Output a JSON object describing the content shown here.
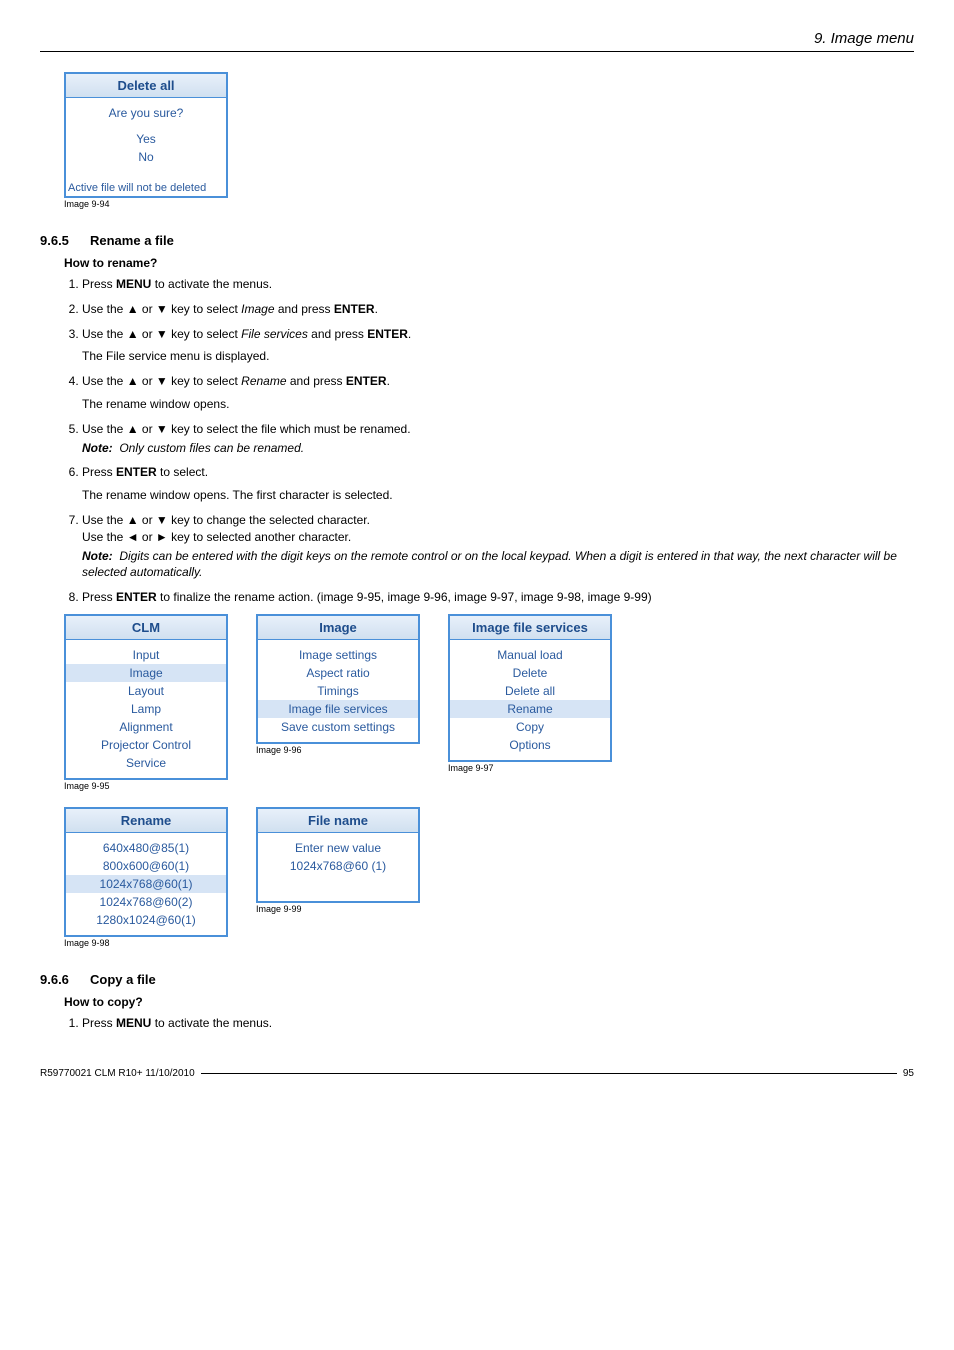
{
  "chapter": "9. Image menu",
  "dialog94": {
    "title": "Delete all",
    "prompt": "Are you sure?",
    "yes": "Yes",
    "no": "No",
    "footer": "Active file will not be deleted",
    "caption": "Image 9-94"
  },
  "section965": {
    "num": "9.6.5",
    "title": "Rename a file",
    "sub": "How to rename?",
    "steps": {
      "s1": "Press ",
      "s1b": "MENU",
      "s1c": " to activate the menus.",
      "s2a": "Use the ▲ or ▼ key to select ",
      "s2i": "Image",
      "s2b": " and press ",
      "s2c": "ENTER",
      "s2d": ".",
      "s3a": "Use the ▲ or ▼ key to select ",
      "s3i": "File services",
      "s3b": " and press ",
      "s3c": "ENTER",
      "s3d": ".",
      "s3e": "The File service menu is displayed.",
      "s4a": "Use the ▲ or ▼ key to select ",
      "s4i": "Rename",
      "s4b": " and press ",
      "s4c": "ENTER",
      "s4d": ".",
      "s4e": "The rename window opens.",
      "s5a": "Use the ▲ or ▼ key to select the file which must be renamed.",
      "s5note": "Only custom files can be renamed.",
      "s6a": "Press ",
      "s6b": "ENTER",
      "s6c": " to select.",
      "s6d": "The rename window opens. The first character is selected.",
      "s7a": "Use the ▲ or ▼ key to change the selected character.",
      "s7b": "Use the ◄ or ► key to selected another character.",
      "s7note": "Digits can be entered with the digit keys on the remote control or on the local keypad. When a digit is entered in that way, the next character will be selected automatically.",
      "s8a": "Press ",
      "s8b": "ENTER",
      "s8c": " to finalize the rename action. (image 9-95, image 9-96, image 9-97, image 9-98, image 9-99)"
    }
  },
  "notelabel": "Note:",
  "menu95": {
    "title": "CLM",
    "items": [
      "Input",
      "Image",
      "Layout",
      "Lamp",
      "Alignment",
      "Projector Control",
      "Service"
    ],
    "highlight": 1,
    "caption": "Image 9-95"
  },
  "menu96": {
    "title": "Image",
    "items": [
      "Image settings",
      "Aspect ratio",
      "Timings",
      "Image file services",
      "Save custom settings"
    ],
    "highlight": 3,
    "caption": "Image 9-96"
  },
  "menu97": {
    "title": "Image file services",
    "items": [
      "Manual load",
      "Delete",
      "Delete all",
      "Rename",
      "Copy",
      "Options"
    ],
    "highlight": 3,
    "caption": "Image 9-97"
  },
  "menu98": {
    "title": "Rename",
    "items": [
      "640x480@85(1)",
      "800x600@60(1)",
      "1024x768@60(1)",
      "1024x768@60(2)",
      "1280x1024@60(1)"
    ],
    "highlight": 2,
    "caption": "Image 9-98"
  },
  "menu99": {
    "title": "File name",
    "line1": "Enter new value",
    "line2": "1024x768@60 (1)",
    "caption": "Image 9-99"
  },
  "section966": {
    "num": "9.6.6",
    "title": "Copy a file",
    "sub": "How to copy?",
    "s1": "Press ",
    "s1b": "MENU",
    "s1c": " to activate the menus."
  },
  "footer": {
    "left": "R59770021  CLM R10+  11/10/2010",
    "right": "95"
  }
}
